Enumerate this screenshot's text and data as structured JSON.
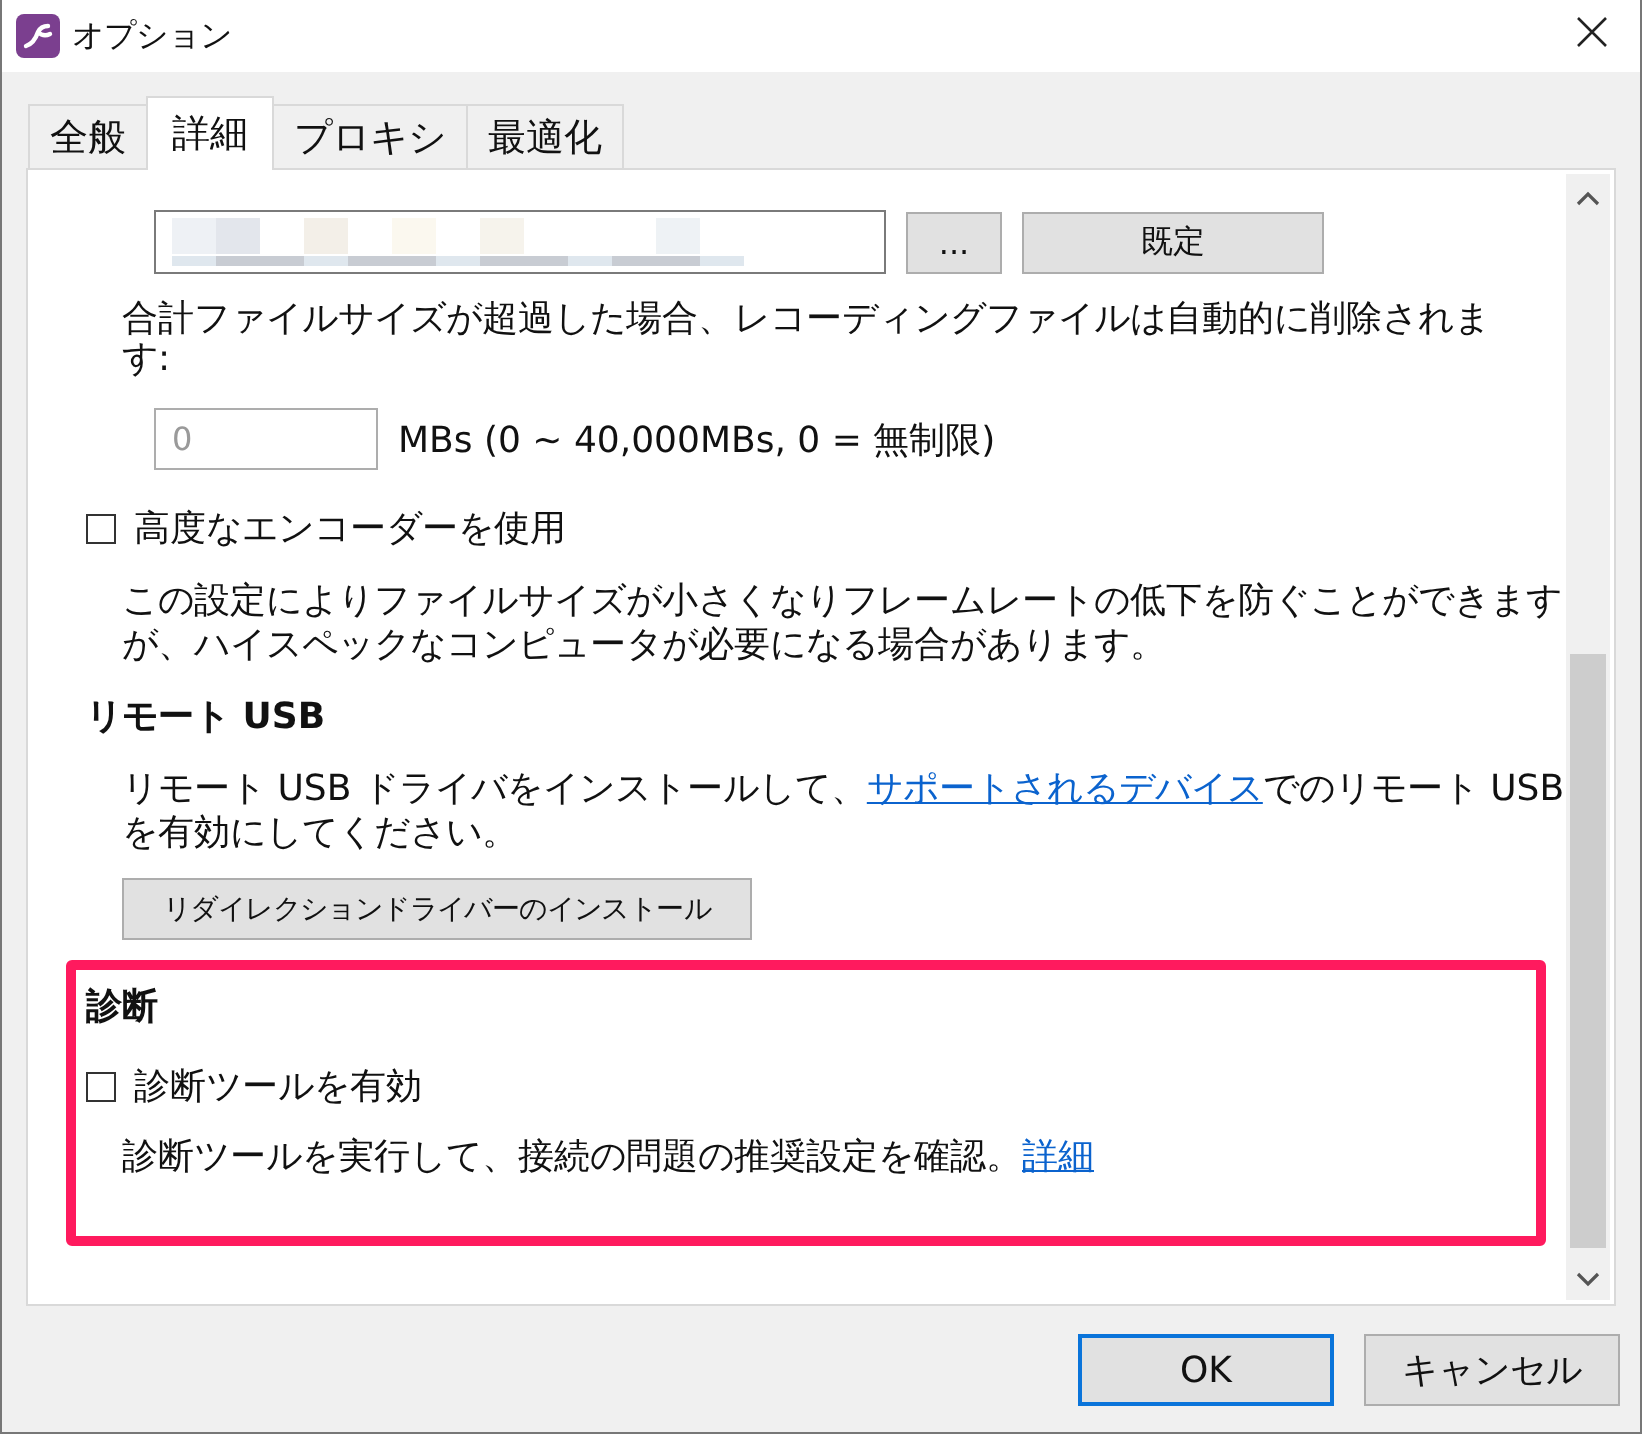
{
  "window": {
    "title": "オプション"
  },
  "tabs": [
    {
      "label": "全般",
      "selected": false
    },
    {
      "label": "詳細",
      "selected": true
    },
    {
      "label": "プロキシ",
      "selected": false
    },
    {
      "label": "最適化",
      "selected": false
    }
  ],
  "recording": {
    "path_field": {
      "redacted": true
    },
    "browse_button": "...",
    "default_button": "既定",
    "limit_note": "合計ファイルサイズが超過した場合、レコーディングファイルは自動的に削除されます:",
    "size_field": {
      "value": "0",
      "disabled": true
    },
    "size_unit": "MBs (0 ~ 40,000MBs, 0 = 無制限)"
  },
  "encoder": {
    "label": "高度なエンコーダーを使用",
    "checked": false,
    "description": "この設定によりファイルサイズが小さくなりフレームレートの低下を防ぐことができますが、ハイスペックなコンピュータが必要になる場合があります。"
  },
  "remote_usb": {
    "heading": "リモート USB",
    "text_before": "リモート USB ドライバをインストールして、",
    "link": "サポートされるデバイス",
    "text_after": "でのリモート USB を有効にしてください。",
    "button": "リダイレクションドライバーのインストール"
  },
  "diagnostics": {
    "heading": "診断",
    "highlighted": true,
    "label": "診断ツールを有効",
    "checked": false,
    "description": "診断ツールを実行して、接続の問題の推奨設定を確認。",
    "link": "詳細"
  },
  "buttons": [
    {
      "label": "OK",
      "default": true
    },
    {
      "label": "キャンセル",
      "default": false
    }
  ]
}
